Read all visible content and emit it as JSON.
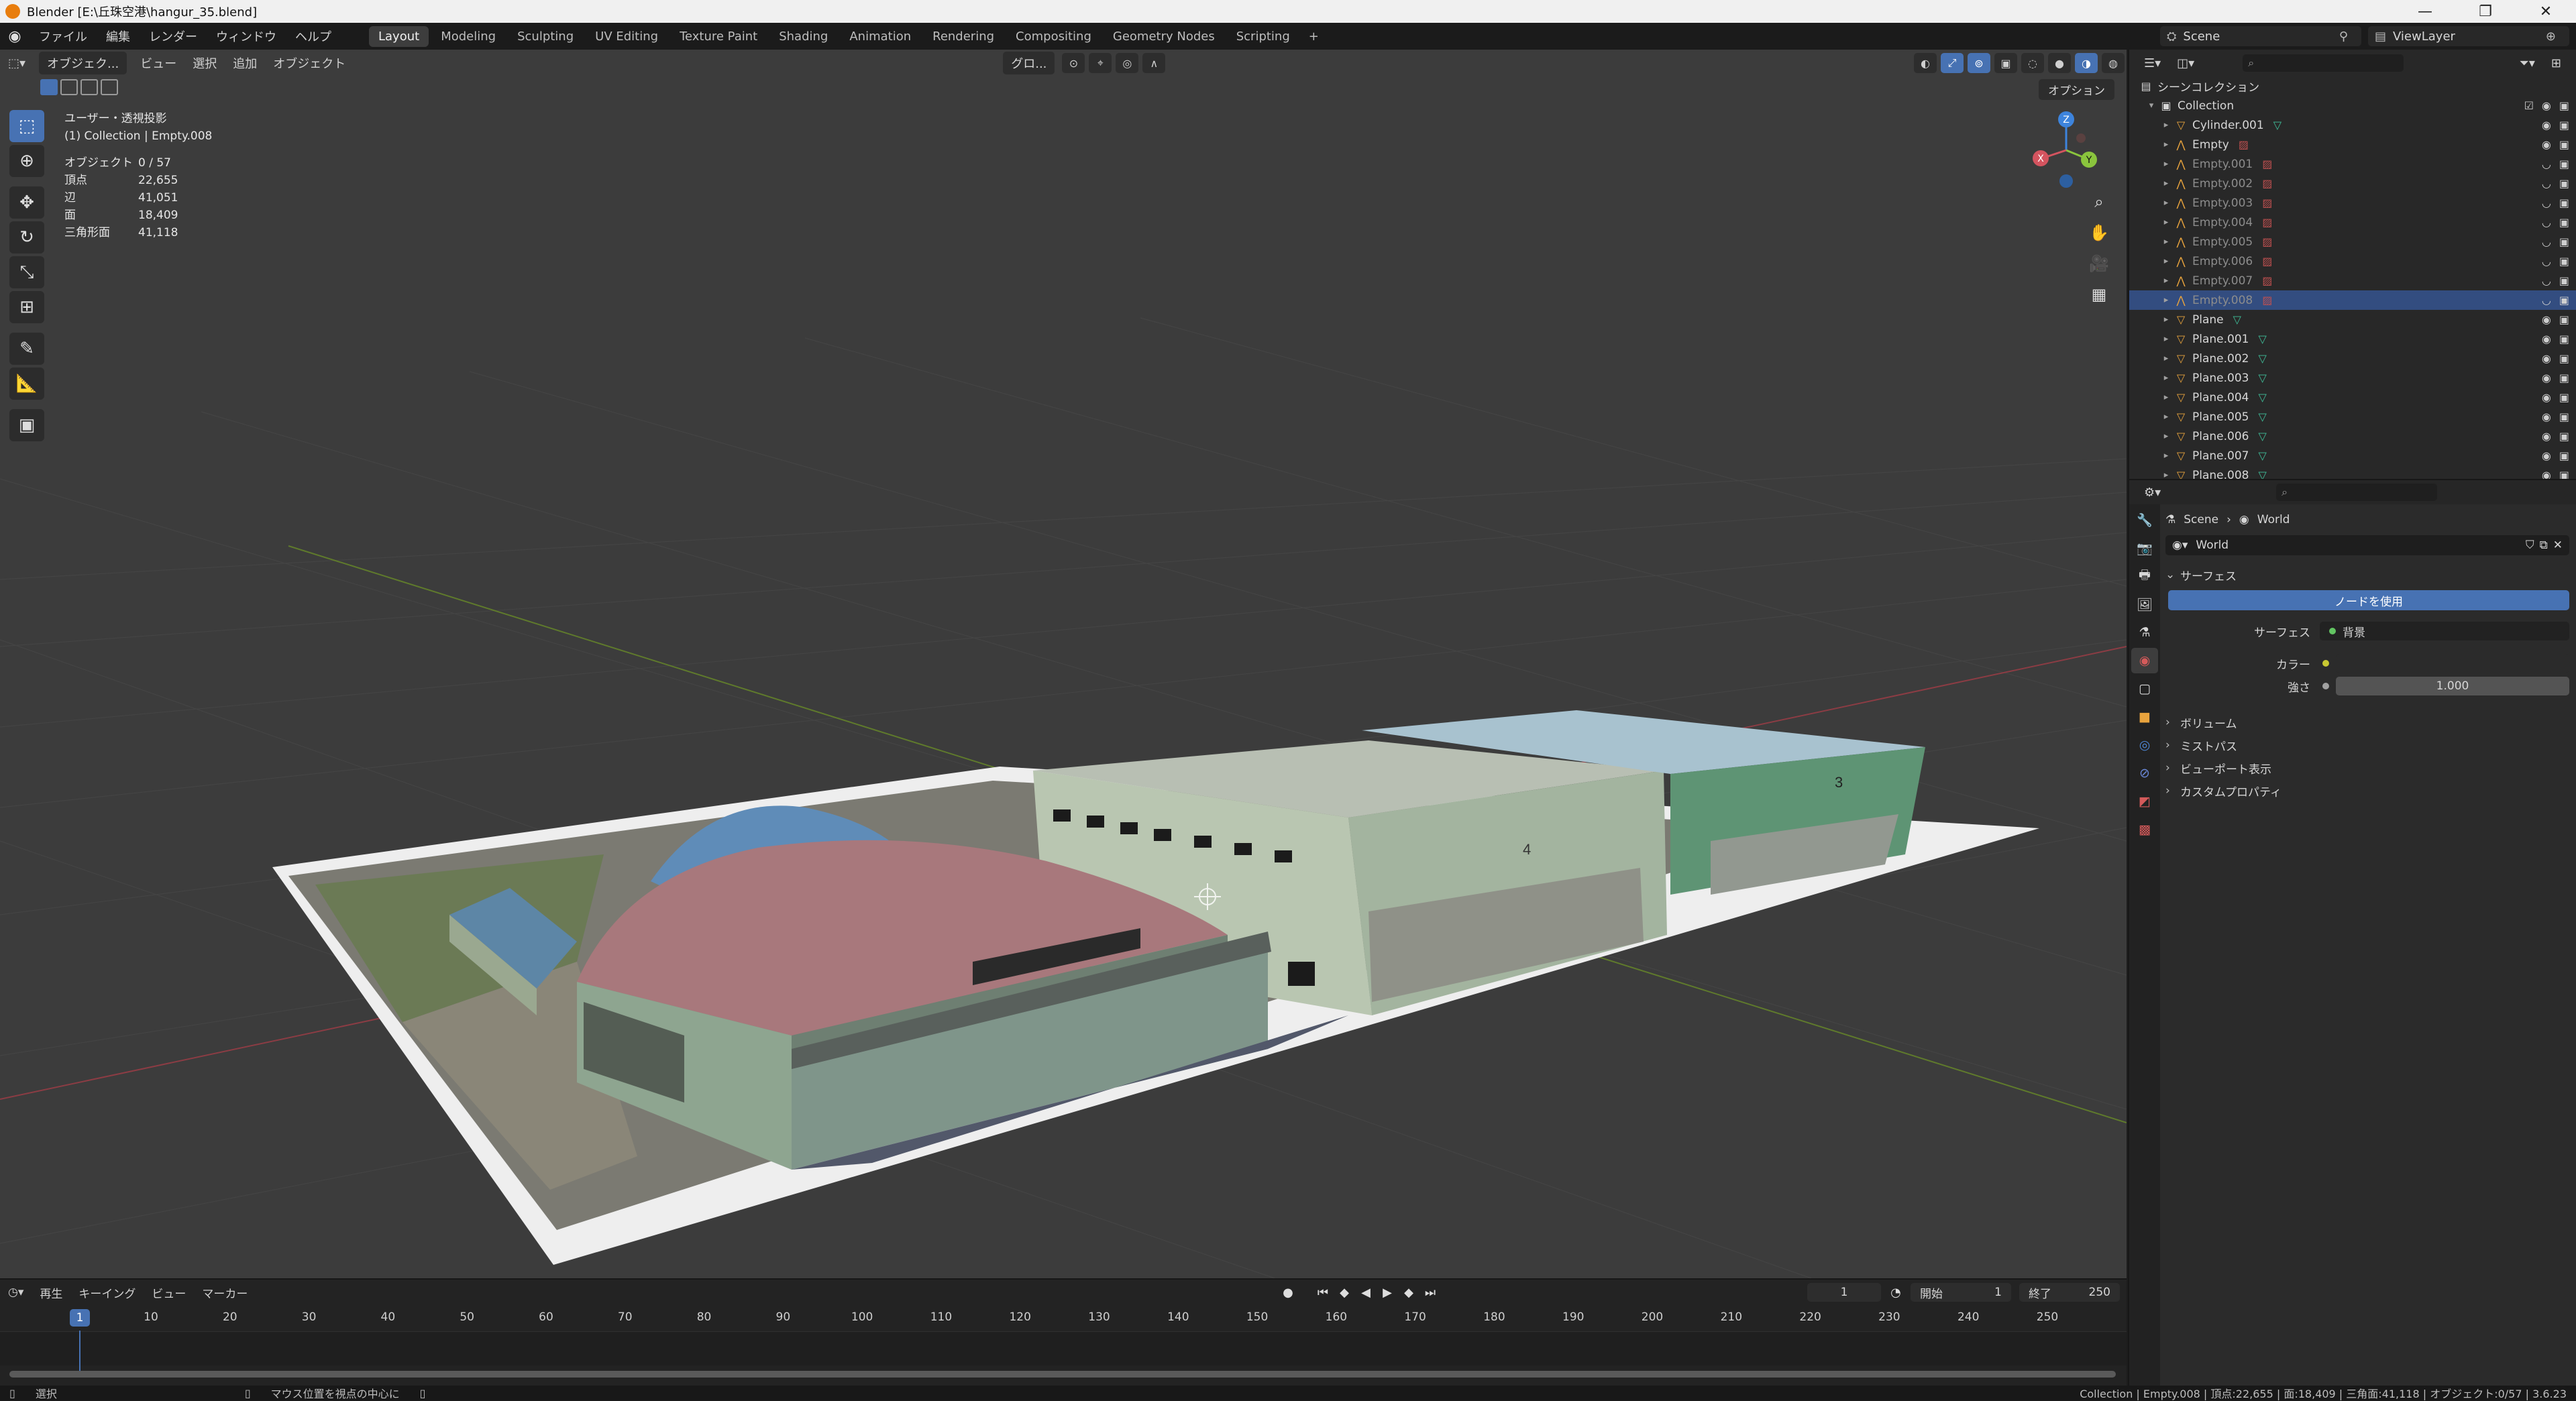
{
  "window": {
    "title": "Blender [E:\\丘珠空港\\hangur_35.blend]",
    "minimize": "—",
    "maximize": "❐",
    "close": "✕"
  },
  "menu": [
    "ファイル",
    "編集",
    "レンダー",
    "ウィンドウ",
    "ヘルプ"
  ],
  "workspaces": [
    "Layout",
    "Modeling",
    "Sculpting",
    "UV Editing",
    "Texture Paint",
    "Shading",
    "Animation",
    "Rendering",
    "Compositing",
    "Geometry Nodes",
    "Scripting"
  ],
  "active_workspace": "Layout",
  "scene_name": "Scene",
  "view_layer": "ViewLayer",
  "viewport": {
    "mode": "オブジェク...",
    "menus": [
      "ビュー",
      "選択",
      "追加",
      "オブジェクト"
    ],
    "transform_orientation": "グロ...",
    "options_label": "オプション",
    "view_name": "ユーザー・透視投影",
    "context": "(1) Collection | Empty.008",
    "stats": [
      {
        "label": "オブジェクト",
        "value": "0 / 57"
      },
      {
        "label": "頂点",
        "value": "22,655"
      },
      {
        "label": "辺",
        "value": "41,051"
      },
      {
        "label": "面",
        "value": "18,409"
      },
      {
        "label": "三角形面",
        "value": "41,118"
      }
    ],
    "building_labels": {
      "hangar_4": "4",
      "hangar_3": "3"
    },
    "gizmo_axes": {
      "z": "Z",
      "y": "Y",
      "x": "X"
    }
  },
  "timeline": {
    "menus": [
      "再生",
      "キーイング",
      "ビュー",
      "マーカー"
    ],
    "current_frame": "1",
    "start_label": "開始",
    "start_value": "1",
    "end_label": "終了",
    "end_value": "250",
    "ticks": [
      "10",
      "20",
      "30",
      "40",
      "50",
      "60",
      "70",
      "80",
      "90",
      "100",
      "110",
      "120",
      "130",
      "140",
      "150",
      "160",
      "170",
      "180",
      "190",
      "200",
      "210",
      "220",
      "230",
      "240",
      "250"
    ]
  },
  "outliner": {
    "scene_collection": "シーンコレクション",
    "collection": "Collection",
    "items": [
      {
        "name": "Cylinder.001",
        "type": "mesh",
        "dim": false,
        "selected": false
      },
      {
        "name": "Empty",
        "type": "empty",
        "dim": false,
        "selected": false
      },
      {
        "name": "Empty.001",
        "type": "empty",
        "dim": true,
        "selected": false
      },
      {
        "name": "Empty.002",
        "type": "empty",
        "dim": true,
        "selected": false
      },
      {
        "name": "Empty.003",
        "type": "empty",
        "dim": true,
        "selected": false
      },
      {
        "name": "Empty.004",
        "type": "empty",
        "dim": true,
        "selected": false
      },
      {
        "name": "Empty.005",
        "type": "empty",
        "dim": true,
        "selected": false
      },
      {
        "name": "Empty.006",
        "type": "empty",
        "dim": true,
        "selected": false
      },
      {
        "name": "Empty.007",
        "type": "empty",
        "dim": true,
        "selected": false
      },
      {
        "name": "Empty.008",
        "type": "empty",
        "dim": true,
        "selected": true
      },
      {
        "name": "Plane",
        "type": "mesh",
        "dim": false,
        "selected": false
      },
      {
        "name": "Plane.001",
        "type": "mesh",
        "dim": false,
        "selected": false
      },
      {
        "name": "Plane.002",
        "type": "mesh",
        "dim": false,
        "selected": false
      },
      {
        "name": "Plane.003",
        "type": "mesh",
        "dim": false,
        "selected": false
      },
      {
        "name": "Plane.004",
        "type": "mesh",
        "dim": false,
        "selected": false
      },
      {
        "name": "Plane.005",
        "type": "mesh",
        "dim": false,
        "selected": false
      },
      {
        "name": "Plane.006",
        "type": "mesh",
        "dim": false,
        "selected": false
      },
      {
        "name": "Plane.007",
        "type": "mesh",
        "dim": false,
        "selected": false
      },
      {
        "name": "Plane.008",
        "type": "mesh",
        "dim": false,
        "selected": false
      }
    ]
  },
  "properties": {
    "breadcrumb": [
      "Scene",
      "World"
    ],
    "world_name": "World",
    "surface_panel": "サーフェス",
    "use_nodes": "ノードを使用",
    "surface_label": "サーフェス",
    "surface_value": "背景",
    "color_label": "カラー",
    "strength_label": "強さ",
    "strength_value": "1.000",
    "panels": [
      "ボリューム",
      "ミストパス",
      "ビューポート表示",
      "カスタムプロパティ"
    ]
  },
  "status": {
    "select": "選択",
    "center_view": "マウス位置を視点の中心に",
    "info": "Collection | Empty.008 | 頂点:22,655 | 面:18,409 | 三角面:41,118 | オブジェクト:0/57 | 3.6.23"
  },
  "colors": {
    "accent": "#4772b3",
    "selected_row": "#334d80",
    "viewport_bg": "#3c3c3c",
    "panel_bg": "#2b2b2b",
    "axis_x": "#d4545f",
    "axis_y": "#8ac43d",
    "axis_z": "#3d84dd"
  },
  "icons": {
    "tools": [
      "select-box-icon",
      "cursor-icon",
      "move-icon",
      "rotate-icon",
      "scale-icon",
      "transform-icon",
      "annotate-icon",
      "measure-icon",
      "add-cube-icon"
    ],
    "nav": [
      "zoom-icon",
      "pan-hand-icon",
      "camera-icon",
      "grid-view-icon"
    ]
  }
}
